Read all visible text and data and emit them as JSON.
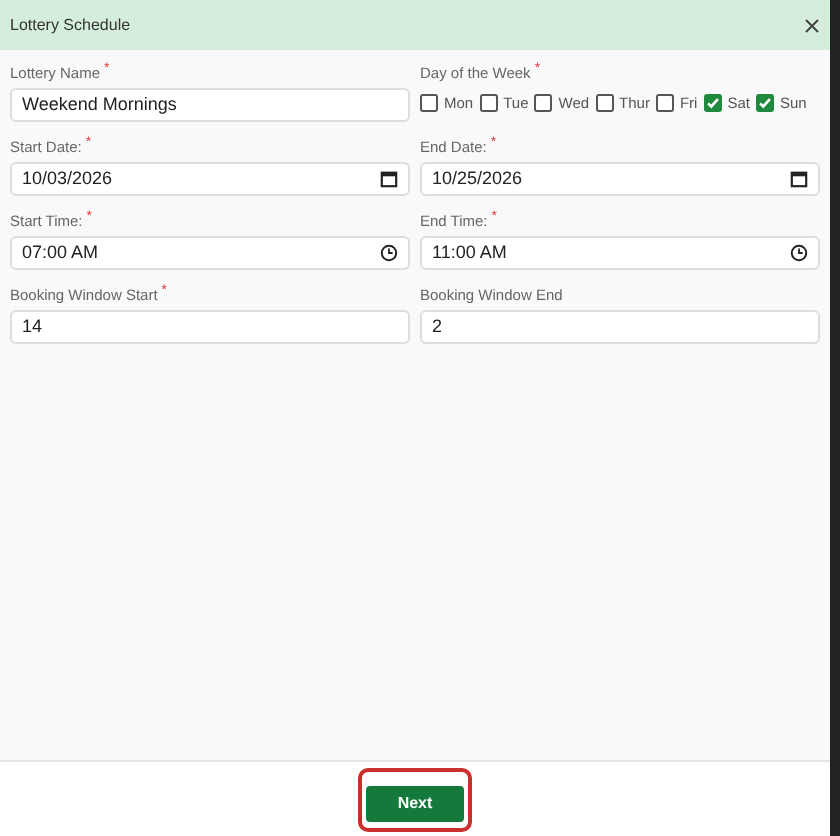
{
  "dialog": {
    "title": "Lottery Schedule"
  },
  "rows": [
    [
      {
        "kind": "text",
        "label": "Lottery Name",
        "required_mark": "*",
        "value": "Weekend Mornings"
      },
      {
        "kind": "days",
        "label": "Day of the Week",
        "required_mark": "*",
        "days": [
          {
            "label": "Mon",
            "checked": false
          },
          {
            "label": "Tue",
            "checked": false
          },
          {
            "label": "Wed",
            "checked": false
          },
          {
            "label": "Thur",
            "checked": false
          },
          {
            "label": "Fri",
            "checked": false
          },
          {
            "label": "Sat",
            "checked": true
          },
          {
            "label": "Sun",
            "checked": true
          }
        ]
      }
    ],
    [
      {
        "kind": "date",
        "label": "Start Date:",
        "required_mark": "*",
        "value": "10/03/2026"
      },
      {
        "kind": "date",
        "label": "End Date:",
        "required_mark": "*",
        "value": "10/25/2026"
      }
    ],
    [
      {
        "kind": "time",
        "label": "Start Time:",
        "required_mark": "*",
        "value": "07:00 AM"
      },
      {
        "kind": "time",
        "label": "End Time:",
        "required_mark": "*",
        "value": "11:00 AM"
      }
    ],
    [
      {
        "kind": "text",
        "label": "Booking Window Start",
        "required_mark": "*",
        "value": "14"
      },
      {
        "kind": "text",
        "label": "Booking Window End",
        "value": "2"
      }
    ]
  ],
  "footer": {
    "button": "Next",
    "highlighted": true
  }
}
